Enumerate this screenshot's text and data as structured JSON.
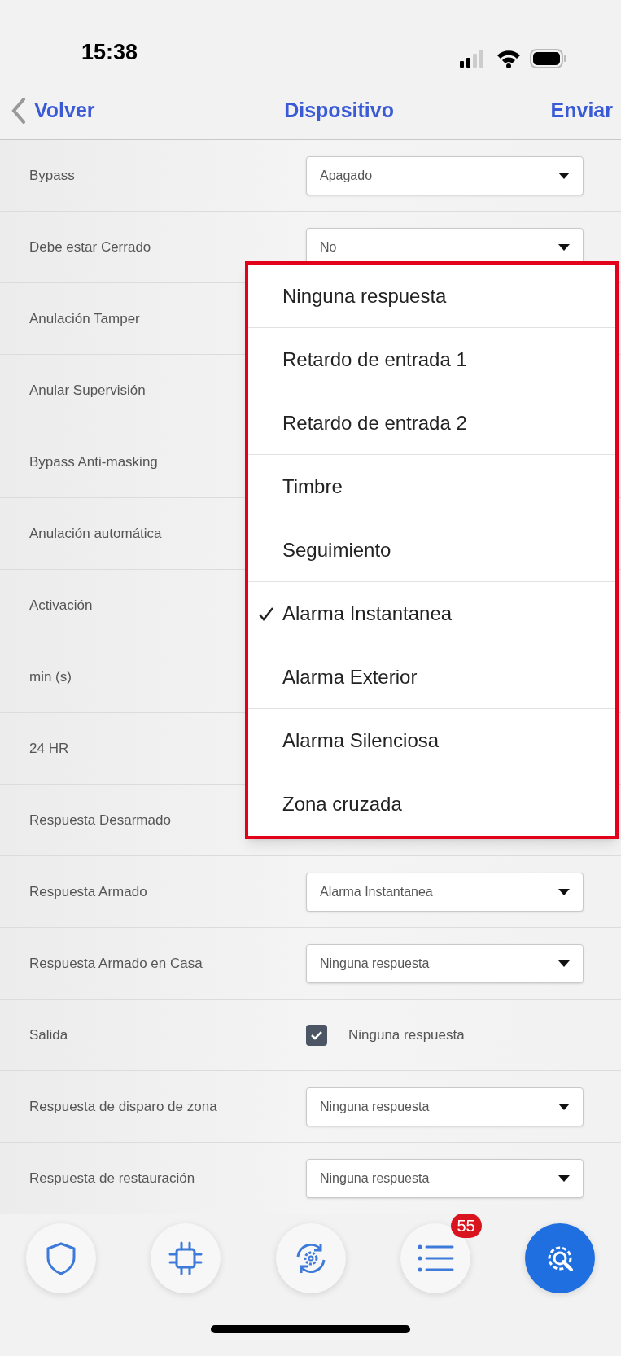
{
  "status_bar": {
    "time": "15:38"
  },
  "nav": {
    "back": "Volver",
    "title": "Dispositivo",
    "action": "Enviar"
  },
  "rows": [
    {
      "label": "Bypass",
      "kind": "select",
      "value": "Apagado"
    },
    {
      "label": "Debe estar Cerrado",
      "kind": "select",
      "value": "No"
    },
    {
      "label": "Anulación Tamper",
      "kind": "covered"
    },
    {
      "label": "Anular Supervisión",
      "kind": "covered"
    },
    {
      "label": "Bypass Anti-masking",
      "kind": "covered"
    },
    {
      "label": "Anulación automática",
      "kind": "covered"
    },
    {
      "label": "Activación",
      "kind": "covered"
    },
    {
      "label": "min (s)",
      "kind": "covered"
    },
    {
      "label": "24 HR",
      "kind": "covered"
    },
    {
      "label": "Respuesta Desarmado",
      "kind": "covered"
    },
    {
      "label": "Respuesta Armado",
      "kind": "select",
      "value": "Alarma Instantanea"
    },
    {
      "label": "Respuesta Armado en Casa",
      "kind": "select",
      "value": "Ninguna respuesta"
    },
    {
      "label": "Salida",
      "kind": "checkbox",
      "checked": true,
      "value": "Ninguna respuesta"
    },
    {
      "label": "Respuesta de disparo de zona",
      "kind": "select",
      "value": "Ninguna respuesta"
    },
    {
      "label": "Respuesta de restauración",
      "kind": "select",
      "value": "Ninguna respuesta"
    }
  ],
  "menu": {
    "options": [
      {
        "label": "Ninguna respuesta",
        "selected": false
      },
      {
        "label": "Retardo de entrada 1",
        "selected": false
      },
      {
        "label": "Retardo de entrada 2",
        "selected": false
      },
      {
        "label": "Timbre",
        "selected": false
      },
      {
        "label": "Seguimiento",
        "selected": false
      },
      {
        "label": "Alarma Instantanea",
        "selected": true
      },
      {
        "label": "Alarma Exterior",
        "selected": false
      },
      {
        "label": "Alarma Silenciosa",
        "selected": false
      },
      {
        "label": "Zona cruzada",
        "selected": false
      }
    ]
  },
  "tab_bar": {
    "tabs": [
      {
        "kind": "shield",
        "selected": false
      },
      {
        "kind": "chip",
        "selected": false
      },
      {
        "kind": "sync",
        "selected": false
      },
      {
        "kind": "list",
        "selected": false,
        "badge": "55"
      },
      {
        "kind": "tools",
        "selected": true
      }
    ]
  }
}
